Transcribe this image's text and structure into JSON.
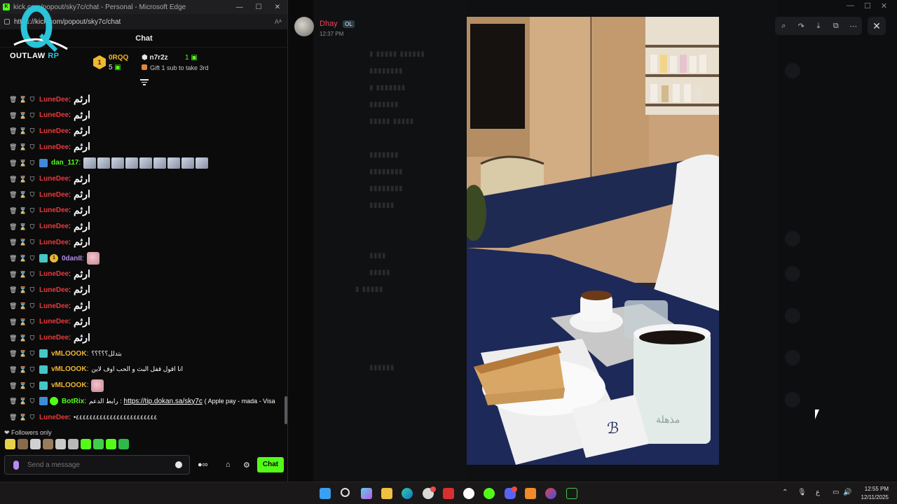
{
  "browser": {
    "title": "kick.com/popout/sky7c/chat - Personal - Microsoft Edge",
    "url": "https://kick.com/popout/sky7c/chat"
  },
  "chat": {
    "header": "Chat",
    "logo_text_a": "OUTLAW",
    "logo_text_b": " RP",
    "leaderboard": {
      "rank": "1",
      "first_name": "0RQQ",
      "first_count": "5",
      "second_name": "n7r2z",
      "second_count": "1",
      "gift_text": "Gift 1 sub to take 3rd"
    },
    "messages": [
      {
        "user": "LuneDee",
        "color": "#ea3a3a",
        "text": "ارثم",
        "kind": "ar"
      },
      {
        "user": "LuneDee",
        "color": "#ea3a3a",
        "text": "ارثم",
        "kind": "ar"
      },
      {
        "user": "LuneDee",
        "color": "#ea3a3a",
        "text": "ارثم",
        "kind": "ar"
      },
      {
        "user": "LuneDee",
        "color": "#ea3a3a",
        "text": "ارثم",
        "kind": "ar"
      },
      {
        "user": "dan_117",
        "color": "#53fc18",
        "text": "",
        "kind": "emotes"
      },
      {
        "user": "LuneDee",
        "color": "#ea3a3a",
        "text": "ارثم",
        "kind": "ar"
      },
      {
        "user": "LuneDee",
        "color": "#ea3a3a",
        "text": "ارثم",
        "kind": "ar"
      },
      {
        "user": "LuneDee",
        "color": "#ea3a3a",
        "text": "ارثم",
        "kind": "ar"
      },
      {
        "user": "LuneDee",
        "color": "#ea3a3a",
        "text": "ارثم",
        "kind": "ar"
      },
      {
        "user": "LuneDee",
        "color": "#ea3a3a",
        "text": "ارثم",
        "kind": "ar"
      },
      {
        "user": "0danII",
        "color": "#b68cf0",
        "text": "",
        "kind": "face"
      },
      {
        "user": "LuneDee",
        "color": "#ea3a3a",
        "text": "ارثم",
        "kind": "ar"
      },
      {
        "user": "LuneDee",
        "color": "#ea3a3a",
        "text": "ارثم",
        "kind": "ar"
      },
      {
        "user": "LuneDee",
        "color": "#ea3a3a",
        "text": "ارثم",
        "kind": "ar"
      },
      {
        "user": "LuneDee",
        "color": "#ea3a3a",
        "text": "ارثم",
        "kind": "ar"
      },
      {
        "user": "LuneDee",
        "color": "#ea3a3a",
        "text": "ارثم",
        "kind": "ar"
      },
      {
        "user": "vMLOOOK",
        "color": "#f0b72f",
        "text": "بتدلل؟؟؟؟؟",
        "kind": "small"
      },
      {
        "user": "vMLOOOK",
        "color": "#f0b72f",
        "text": "انا اقول قفل البث و الحب اوف لاين",
        "kind": "small"
      },
      {
        "user": "vMLOOOK",
        "color": "#f0b72f",
        "text": "",
        "kind": "face"
      },
      {
        "user": "BotRix",
        "color": "#53fc18",
        "text_prefix": "رابط الدعم :",
        "link": "https://tip.dokan.sa/sky7c",
        "text": "( Apple pay - mada - Visa",
        "kind": "link"
      },
      {
        "user": "LuneDee",
        "color": "#ea3a3a",
        "text": "•٤٤٤٤٤٤٤٤٤٤٤٤٤٤٤٤٤٤٤٤٤٤٤٤",
        "kind": "small"
      }
    ],
    "followers_only": "Followers only",
    "input_placeholder": "Send a message",
    "chat_button": "Chat"
  },
  "viewer": {
    "username": "Dhay",
    "badge": "OL",
    "time": "12:37 PM",
    "close": "✕"
  },
  "taskbar": {
    "time": "12:55 PM",
    "date": "12/11/2025",
    "lang": "ع"
  },
  "colors": {
    "kick_green": "#53fc18",
    "lune_red": "#ea3a3a",
    "taskbar_bg": "#1a1818"
  }
}
